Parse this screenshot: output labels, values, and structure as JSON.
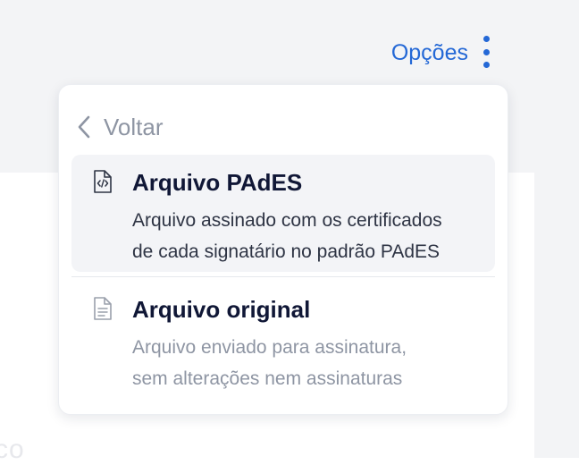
{
  "header": {
    "options_label": "Opções"
  },
  "background": {
    "partial_text": "co"
  },
  "menu": {
    "back_label": "Voltar",
    "items": [
      {
        "title": "Arquivo PAdES",
        "description_line1": "Arquivo assinado com os certificados",
        "description_line2": "de cada signatário no padrão PAdES",
        "icon": "file-code-icon",
        "highlighted": true
      },
      {
        "title": "Arquivo original",
        "description_line1": "Arquivo enviado para assinatura,",
        "description_line2": "sem alterações nem assinaturas",
        "icon": "file-text-icon",
        "highlighted": false
      }
    ]
  },
  "colors": {
    "accent": "#2468d6",
    "title_text": "#101736",
    "muted_text": "#8e95a3",
    "background_gray": "#f3f4f6"
  }
}
